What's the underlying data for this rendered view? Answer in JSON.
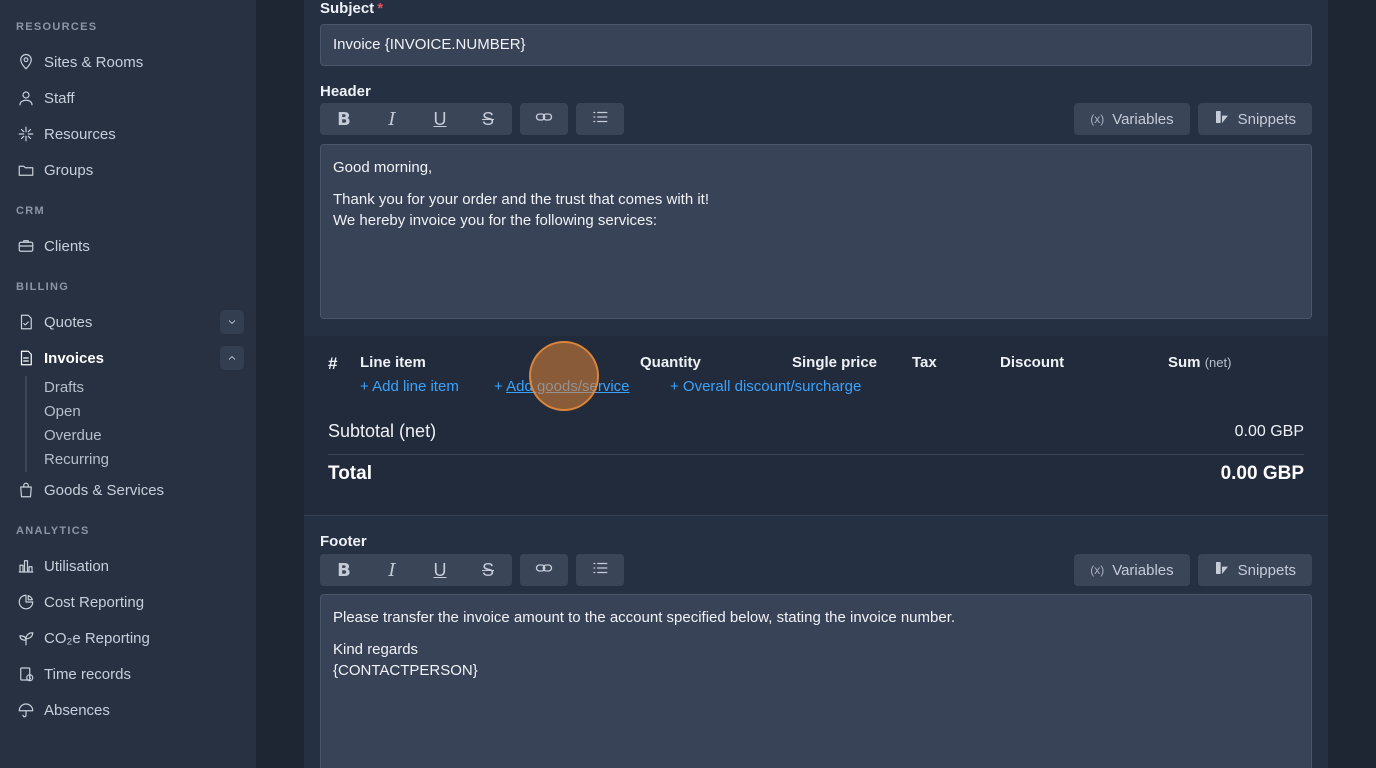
{
  "sidebar": {
    "sections": {
      "resources": "RESOURCES",
      "crm": "CRM",
      "billing": "BILLING",
      "analytics": "ANALYTICS"
    },
    "items": {
      "sites_rooms": "Sites & Rooms",
      "staff": "Staff",
      "resources": "Resources",
      "groups": "Groups",
      "clients": "Clients",
      "quotes": "Quotes",
      "invoices": "Invoices",
      "goods_services": "Goods & Services",
      "utilisation": "Utilisation",
      "cost_reporting": "Cost Reporting",
      "co2_reporting": "CO₂e Reporting",
      "time_records": "Time records",
      "absences": "Absences"
    },
    "invoice_subitems": [
      "Drafts",
      "Open",
      "Overdue",
      "Recurring"
    ]
  },
  "form": {
    "subject_label": "Subject",
    "required_mark": "*",
    "subject_value": "Invoice {INVOICE.NUMBER}",
    "header_label": "Header",
    "footer_label": "Footer",
    "variables_label": "Variables",
    "variables_glyph": "(x)",
    "snippets_label": "Snippets",
    "header_text": {
      "greeting": "Good morning,",
      "line1": "Thank you for your order and the trust that comes with it!",
      "line2": "We hereby invoice you for the following services:"
    },
    "footer_text": {
      "line1": "Please transfer the invoice amount to the account specified below, stating the invoice number.",
      "regards": "Kind regards",
      "contact": "{CONTACTPERSON}"
    }
  },
  "line_items": {
    "hash": "#",
    "columns": {
      "line_item": "Line item",
      "quantity": "Quantity",
      "single_price": "Single price",
      "tax": "Tax",
      "discount": "Discount",
      "sum": "Sum",
      "sum_suffix": "(net)"
    },
    "actions": {
      "add_line_item": "+ Add line item",
      "add_goods_prefix": "+ ",
      "add_goods": "Add goods/service",
      "overall_discount": "+ Overall discount/surcharge"
    },
    "subtotal_label": "Subtotal (net)",
    "subtotal_value": "0.00 GBP",
    "total_label": "Total",
    "total_value": "0.00 GBP"
  },
  "colors": {
    "link": "#3aa3ff",
    "required": "#e2545b",
    "cursor_highlight": "#de8436"
  }
}
